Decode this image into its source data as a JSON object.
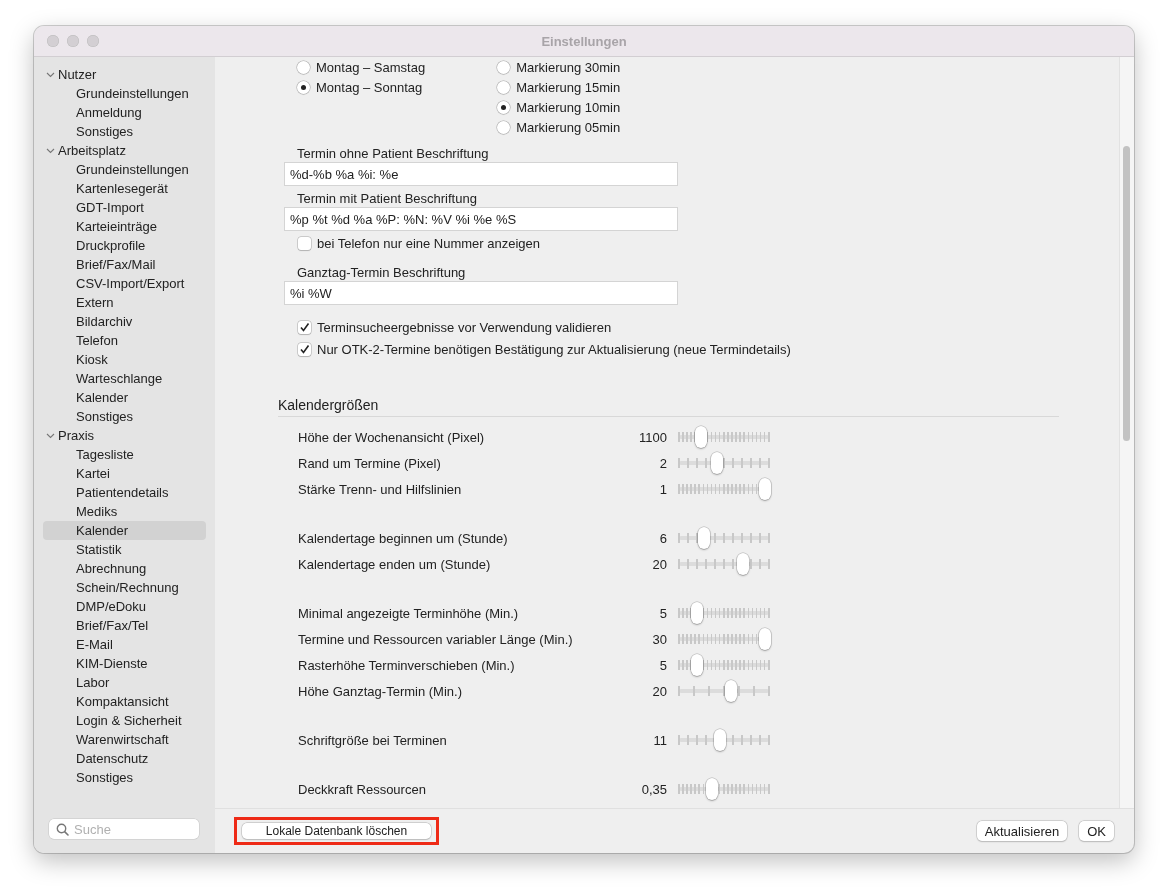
{
  "window": {
    "title": "Einstellungen"
  },
  "sidebar": {
    "groups": [
      {
        "label": "Nutzer",
        "expanded": true,
        "children": [
          {
            "label": "Grundeinstellungen",
            "selected": false
          },
          {
            "label": "Anmeldung",
            "selected": false
          },
          {
            "label": "Sonstiges",
            "selected": false
          }
        ]
      },
      {
        "label": "Arbeitsplatz",
        "expanded": true,
        "children": [
          {
            "label": "Grundeinstellungen",
            "selected": false
          },
          {
            "label": "Kartenlesegerät",
            "selected": false
          },
          {
            "label": "GDT-Import",
            "selected": false
          },
          {
            "label": "Karteieinträge",
            "selected": false
          },
          {
            "label": "Druckprofile",
            "selected": false
          },
          {
            "label": "Brief/Fax/Mail",
            "selected": false
          },
          {
            "label": "CSV-Import/Export",
            "selected": false
          },
          {
            "label": "Extern",
            "selected": false
          },
          {
            "label": "Bildarchiv",
            "selected": false
          },
          {
            "label": "Telefon",
            "selected": false
          },
          {
            "label": "Kiosk",
            "selected": false
          },
          {
            "label": "Warteschlange",
            "selected": false
          },
          {
            "label": "Kalender",
            "selected": false
          },
          {
            "label": "Sonstiges",
            "selected": false
          }
        ]
      },
      {
        "label": "Praxis",
        "expanded": true,
        "children": [
          {
            "label": "Tagesliste",
            "selected": false
          },
          {
            "label": "Kartei",
            "selected": false
          },
          {
            "label": "Patientendetails",
            "selected": false
          },
          {
            "label": "Mediks",
            "selected": false
          },
          {
            "label": "Kalender",
            "selected": true
          },
          {
            "label": "Statistik",
            "selected": false
          },
          {
            "label": "Abrechnung",
            "selected": false
          },
          {
            "label": "Schein/Rechnung",
            "selected": false
          },
          {
            "label": "DMP/eDoku",
            "selected": false
          },
          {
            "label": "Brief/Fax/Tel",
            "selected": false
          },
          {
            "label": "E-Mail",
            "selected": false
          },
          {
            "label": "KIM-Dienste",
            "selected": false
          },
          {
            "label": "Labor",
            "selected": false
          },
          {
            "label": "Kompaktansicht",
            "selected": false
          },
          {
            "label": "Login & Sicherheit",
            "selected": false
          },
          {
            "label": "Warenwirtschaft",
            "selected": false
          },
          {
            "label": "Datenschutz",
            "selected": false
          },
          {
            "label": "Sonstiges",
            "selected": false
          }
        ]
      }
    ],
    "search": {
      "placeholder": "Suche"
    }
  },
  "days_radios": [
    {
      "label": "Montag – Samstag",
      "selected": false
    },
    {
      "label": "Montag – Sonntag",
      "selected": true
    }
  ],
  "marking_radios": [
    {
      "label": "Markierung 30min",
      "selected": false
    },
    {
      "label": "Markierung 15min",
      "selected": false
    },
    {
      "label": "Markierung 10min",
      "selected": true
    },
    {
      "label": "Markierung 05min",
      "selected": false
    }
  ],
  "fields": [
    {
      "label": "Termin ohne Patient Beschriftung",
      "value": "%d-%b %a %i: %e"
    },
    {
      "label": "Termin mit Patient Beschriftung",
      "value": "%p %t %d %a %P: %N: %V %i %e %S"
    }
  ],
  "phone_checkbox": {
    "label": "bei Telefon nur eine Nummer anzeigen",
    "checked": false
  },
  "allday_field": {
    "label": "Ganztag-Termin Beschriftung",
    "value": "%i %W"
  },
  "checkboxes": [
    {
      "label": "Terminsucheergebnisse vor Verwendung validieren",
      "checked": true
    },
    {
      "label": "Nur OTK-2-Termine benötigen Bestätigung zur Aktualisierung (neue Termindetails)",
      "checked": true
    }
  ],
  "section_title": "Kalendergrößen",
  "slider_groups": [
    [
      {
        "label": "Höhe der Wochenansicht (Pixel)",
        "reading": "1100",
        "level": 0.22,
        "kind": "fine"
      },
      {
        "label": "Rand um Termine (Pixel)",
        "reading": "2",
        "level": 0.41,
        "kind": "medium"
      },
      {
        "label": "Stärke Trenn- und Hilfslinien",
        "reading": "1",
        "level": 1.0,
        "kind": "fine"
      }
    ],
    [
      {
        "label": "Kalendertage beginnen um (Stunde)",
        "reading": "6",
        "level": 0.26,
        "kind": "medium"
      },
      {
        "label": "Kalendertage enden um (Stunde)",
        "reading": "20",
        "level": 0.73,
        "kind": "medium"
      }
    ],
    [
      {
        "label": "Minimal angezeigte Terminhöhe (Min.)",
        "reading": "5",
        "level": 0.17,
        "kind": "fine"
      },
      {
        "label": "Termine und Ressourcen variabler Länge (Min.)",
        "reading": "30",
        "level": 1.0,
        "kind": "fine"
      },
      {
        "label": "Rasterhöhe Terminverschieben (Min.)",
        "reading": "5",
        "level": 0.17,
        "kind": "fine"
      },
      {
        "label": "Höhe Ganztag-Termin (Min.)",
        "reading": "20",
        "level": 0.59,
        "kind": "coarse"
      }
    ],
    [
      {
        "label": "Schriftgröße bei Terminen",
        "reading": "11",
        "level": 0.45,
        "kind": "medium"
      }
    ],
    [
      {
        "label": "Deckkraft Ressourcen",
        "reading": "0,35",
        "level": 0.35,
        "kind": "fine"
      }
    ]
  ],
  "footer": {
    "delete_button": {
      "label": "Lokale Datenbank löschen",
      "highlighted": true
    },
    "buttons": [
      "Aktualisieren",
      "OK"
    ]
  }
}
